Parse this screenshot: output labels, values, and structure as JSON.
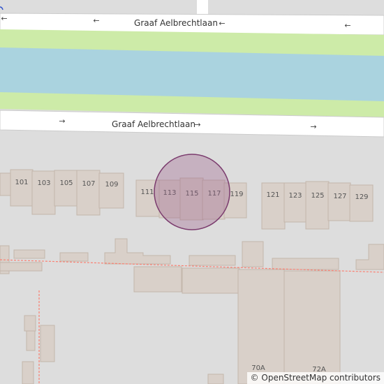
{
  "streets": {
    "north": "Graaf Aelbrechtlaan",
    "south": "Graaf Aelbrechtlaan"
  },
  "arrows": {
    "symbol_left": "←",
    "symbol_right": "→"
  },
  "house_numbers": [
    "101",
    "103",
    "105",
    "107",
    "109",
    "111",
    "113",
    "115",
    "117",
    "119",
    "121",
    "123",
    "125",
    "127",
    "129"
  ],
  "partial_labels": [
    "70A",
    "72A"
  ],
  "attribution": {
    "copyright": "©",
    "link_text": "OpenStreetMap contributors"
  },
  "colors": {
    "background": "#dddddd",
    "road": "#ffffff",
    "grass": "#cdeba8",
    "water": "#aad3df",
    "building": "#d9d0c9",
    "building_outline": "#c4b6ab",
    "marker_fill": "#9c5f8a",
    "marker_stroke": "#7b3c6e",
    "path": "#fa8072"
  }
}
